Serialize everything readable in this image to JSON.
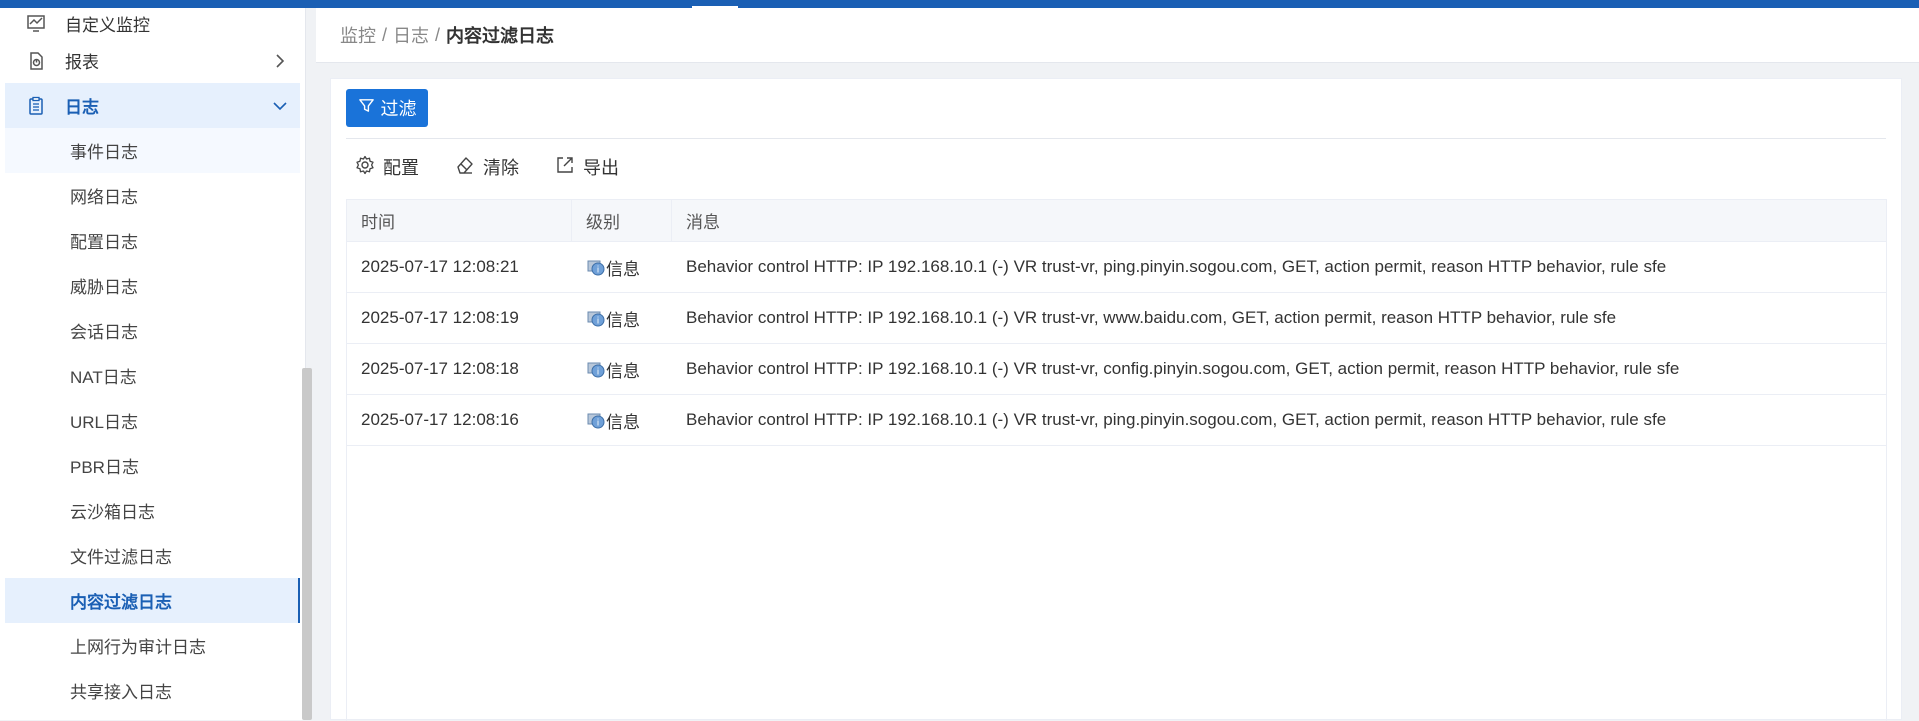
{
  "breadcrumb": {
    "items": [
      "监控",
      "日志"
    ],
    "current": "内容过滤日志",
    "separator": "/"
  },
  "sidebar": {
    "top_items": [
      {
        "label": "自定义监控",
        "icon": "chart-monitor-icon"
      },
      {
        "label": "报表",
        "icon": "report-icon"
      },
      {
        "label": "日志",
        "icon": "log-clipboard-icon"
      }
    ],
    "sub_items": [
      "事件日志",
      "网络日志",
      "配置日志",
      "威胁日志",
      "会话日志",
      "NAT日志",
      "URL日志",
      "PBR日志",
      "云沙箱日志",
      "文件过滤日志",
      "内容过滤日志",
      "上网行为审计日志",
      "共享接入日志"
    ],
    "active_sub_index": 10
  },
  "toolbar": {
    "filter_label": "过滤",
    "config_label": "配置",
    "clear_label": "清除",
    "export_label": "导出"
  },
  "table": {
    "headers": [
      "时间",
      "级别",
      "消息"
    ],
    "rows": [
      {
        "time": "2025-07-17 12:08:21",
        "level": "信息",
        "message": "Behavior control HTTP: IP 192.168.10.1 (-) VR trust-vr, ping.pinyin.sogou.com, GET, action permit, reason HTTP behavior, rule sfe"
      },
      {
        "time": "2025-07-17 12:08:19",
        "level": "信息",
        "message": "Behavior control HTTP: IP 192.168.10.1 (-) VR trust-vr, www.baidu.com, GET, action permit, reason HTTP behavior, rule sfe"
      },
      {
        "time": "2025-07-17 12:08:18",
        "level": "信息",
        "message": "Behavior control HTTP: IP 192.168.10.1 (-) VR trust-vr, config.pinyin.sogou.com, GET, action permit, reason HTTP behavior, rule sfe"
      },
      {
        "time": "2025-07-17 12:08:16",
        "level": "信息",
        "message": "Behavior control HTTP: IP 192.168.10.1 (-) VR trust-vr, ping.pinyin.sogou.com, GET, action permit, reason HTTP behavior, rule sfe"
      }
    ]
  },
  "colors": {
    "accent": "#1a73d9",
    "topbar": "#1a5fb4",
    "active_bg": "#e6f0fd"
  }
}
